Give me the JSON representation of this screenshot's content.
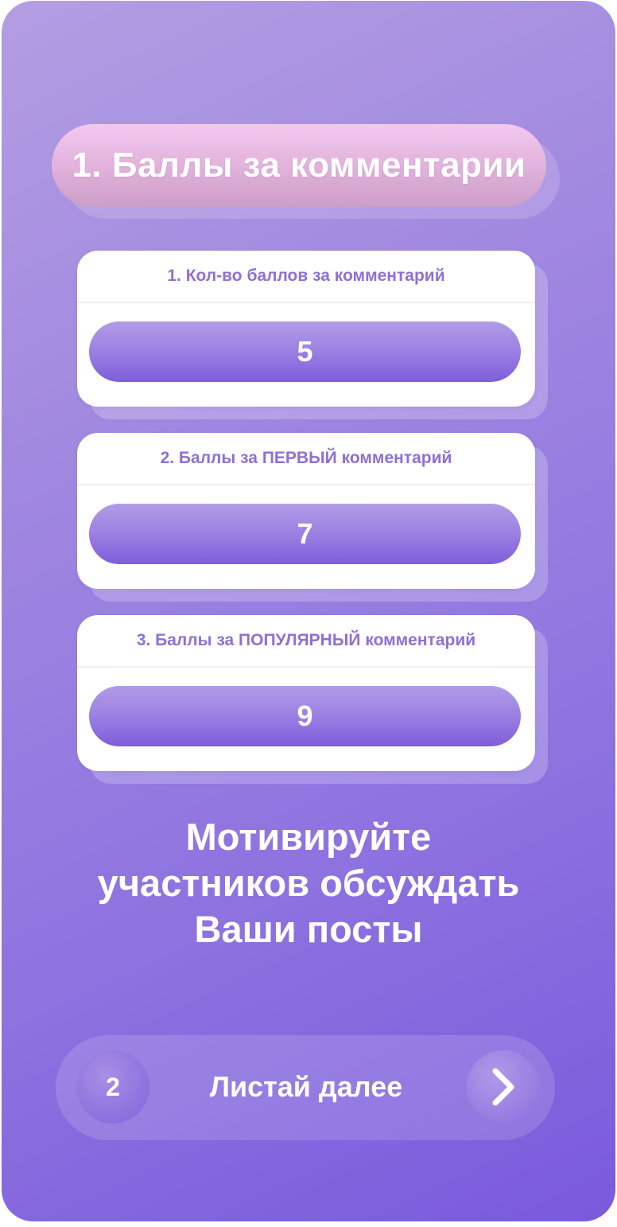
{
  "title": "1. Баллы за комментарии",
  "settings": [
    {
      "label": "1. Кол-во баллов за комментарий",
      "value": "5"
    },
    {
      "label": "2. Баллы за ПЕРВЫЙ комментарий",
      "value": "7"
    },
    {
      "label": "3. Баллы за ПОПУЛЯРНЫЙ комментарий",
      "value": "9"
    }
  ],
  "motto": {
    "line1": "Мотивируйте",
    "line2": "участников обсуждать",
    "line3": "Ваши посты"
  },
  "nav": {
    "page_number": "2",
    "next_label": "Листай далее",
    "arrow_icon": "chevron-right-icon"
  },
  "colors": {
    "background_start": "#b39ee2",
    "background_end": "#7a5adc",
    "title_pill": "#e2b3dc",
    "label_text": "#8f6fd6",
    "value_pill": "#9b80e2"
  }
}
